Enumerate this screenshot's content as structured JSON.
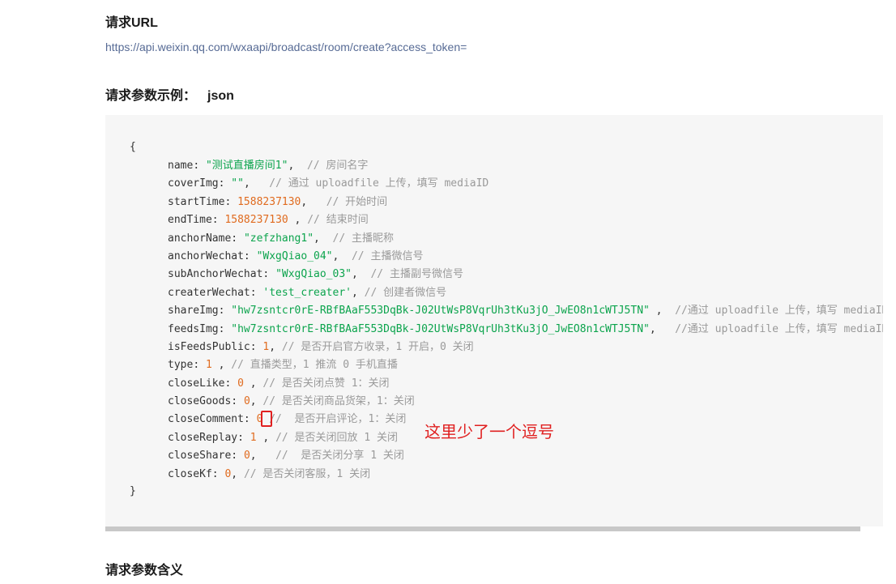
{
  "request_url": {
    "heading": "请求URL",
    "url": "https://api.weixin.qq.com/wxaapi/broadcast/room/create?access_token="
  },
  "example": {
    "heading": "请求参数示例：",
    "format": "json",
    "open_brace": "{",
    "close_brace": "}",
    "lines": [
      [
        {
          "t": "k",
          "v": "name"
        },
        {
          "t": "p",
          "v": ": "
        },
        {
          "t": "s",
          "v": "\"测试直播房间1\""
        },
        {
          "t": "p",
          "v": ",  "
        },
        {
          "t": "c",
          "v": "// 房间名字"
        }
      ],
      [
        {
          "t": "k",
          "v": "coverImg"
        },
        {
          "t": "p",
          "v": ": "
        },
        {
          "t": "s",
          "v": "\"\""
        },
        {
          "t": "p",
          "v": ",   "
        },
        {
          "t": "c",
          "v": "// 通过 uploadfile 上传，填写 mediaID"
        }
      ],
      [
        {
          "t": "k",
          "v": "startTime"
        },
        {
          "t": "p",
          "v": ": "
        },
        {
          "t": "n",
          "v": "1588237130"
        },
        {
          "t": "p",
          "v": ",   "
        },
        {
          "t": "c",
          "v": "// 开始时间"
        }
      ],
      [
        {
          "t": "k",
          "v": "endTime"
        },
        {
          "t": "p",
          "v": ": "
        },
        {
          "t": "n",
          "v": "1588237130"
        },
        {
          "t": "p",
          "v": " , "
        },
        {
          "t": "c",
          "v": "// 结束时间"
        }
      ],
      [
        {
          "t": "k",
          "v": "anchorName"
        },
        {
          "t": "p",
          "v": ": "
        },
        {
          "t": "s",
          "v": "\"zefzhang1\""
        },
        {
          "t": "p",
          "v": ",  "
        },
        {
          "t": "c",
          "v": "// 主播昵称"
        }
      ],
      [
        {
          "t": "k",
          "v": "anchorWechat"
        },
        {
          "t": "p",
          "v": ": "
        },
        {
          "t": "s",
          "v": "\"WxgQiao_04\""
        },
        {
          "t": "p",
          "v": ",  "
        },
        {
          "t": "c",
          "v": "// 主播微信号"
        }
      ],
      [
        {
          "t": "k",
          "v": "subAnchorWechat"
        },
        {
          "t": "p",
          "v": ": "
        },
        {
          "t": "s",
          "v": "\"WxgQiao_03\""
        },
        {
          "t": "p",
          "v": ",  "
        },
        {
          "t": "c",
          "v": "// 主播副号微信号"
        }
      ],
      [
        {
          "t": "k",
          "v": "createrWechat"
        },
        {
          "t": "p",
          "v": ": "
        },
        {
          "t": "s",
          "v": "'test_creater'"
        },
        {
          "t": "p",
          "v": ", "
        },
        {
          "t": "c",
          "v": "// 创建者微信号"
        }
      ],
      [
        {
          "t": "k",
          "v": "shareImg"
        },
        {
          "t": "p",
          "v": ": "
        },
        {
          "t": "s",
          "v": "\"hw7zsntcr0rE-RBfBAaF553DqBk-J02UtWsP8VqrUh3tKu3jO_JwEO8n1cWTJ5TN\""
        },
        {
          "t": "p",
          "v": " ,  "
        },
        {
          "t": "c",
          "v": "//通过 uploadfile 上传，填写 mediaID"
        }
      ],
      [
        {
          "t": "k",
          "v": "feedsImg"
        },
        {
          "t": "p",
          "v": ": "
        },
        {
          "t": "s",
          "v": "\"hw7zsntcr0rE-RBfBAaF553DqBk-J02UtWsP8VqrUh3tKu3jO_JwEO8n1cWTJ5TN\""
        },
        {
          "t": "p",
          "v": ",   "
        },
        {
          "t": "c",
          "v": "//通过 uploadfile 上传，填写 mediaID"
        }
      ],
      [
        {
          "t": "k",
          "v": "isFeedsPublic"
        },
        {
          "t": "p",
          "v": ": "
        },
        {
          "t": "n",
          "v": "1"
        },
        {
          "t": "p",
          "v": ", "
        },
        {
          "t": "c",
          "v": "// 是否开启官方收录，1 开启，0 关闭"
        }
      ],
      [
        {
          "t": "k",
          "v": "type"
        },
        {
          "t": "p",
          "v": ": "
        },
        {
          "t": "n",
          "v": "1"
        },
        {
          "t": "p",
          "v": " , "
        },
        {
          "t": "c",
          "v": "// 直播类型，1 推流 0 手机直播"
        }
      ],
      [
        {
          "t": "k",
          "v": "closeLike"
        },
        {
          "t": "p",
          "v": ": "
        },
        {
          "t": "n",
          "v": "0"
        },
        {
          "t": "p",
          "v": " , "
        },
        {
          "t": "c",
          "v": "// 是否关闭点赞 1：关闭"
        }
      ],
      [
        {
          "t": "k",
          "v": "closeGoods"
        },
        {
          "t": "p",
          "v": ": "
        },
        {
          "t": "n",
          "v": "0"
        },
        {
          "t": "p",
          "v": ", "
        },
        {
          "t": "c",
          "v": "// 是否关闭商品货架，1：关闭"
        }
      ],
      [
        {
          "t": "k",
          "v": "closeComment"
        },
        {
          "t": "p",
          "v": ": "
        },
        {
          "t": "n",
          "v": "0"
        },
        {
          "t": "p",
          "v": " "
        },
        {
          "t": "c",
          "v": "//  是否开启评论，1：关闭"
        }
      ],
      [
        {
          "t": "k",
          "v": "closeReplay"
        },
        {
          "t": "p",
          "v": ": "
        },
        {
          "t": "n",
          "v": "1"
        },
        {
          "t": "p",
          "v": " , "
        },
        {
          "t": "c",
          "v": "// 是否关闭回放 1 关闭"
        }
      ],
      [
        {
          "t": "k",
          "v": "closeShare"
        },
        {
          "t": "p",
          "v": ": "
        },
        {
          "t": "n",
          "v": "0"
        },
        {
          "t": "p",
          "v": ",   "
        },
        {
          "t": "c",
          "v": "//  是否关闭分享 1 关闭"
        }
      ],
      [
        {
          "t": "k",
          "v": "closeKf"
        },
        {
          "t": "p",
          "v": ": "
        },
        {
          "t": "n",
          "v": "0"
        },
        {
          "t": "p",
          "v": ", "
        },
        {
          "t": "c",
          "v": "// 是否关闭客服，1 关闭"
        }
      ]
    ],
    "annotation": "这里少了一个逗号"
  },
  "meaning": {
    "heading": "请求参数含义"
  },
  "colors": {
    "key": "#333333",
    "string": "#0ca44d",
    "number": "#e06b1f",
    "comment": "#9a9a9a",
    "annotation": "#e02020",
    "link": "#576b95"
  }
}
